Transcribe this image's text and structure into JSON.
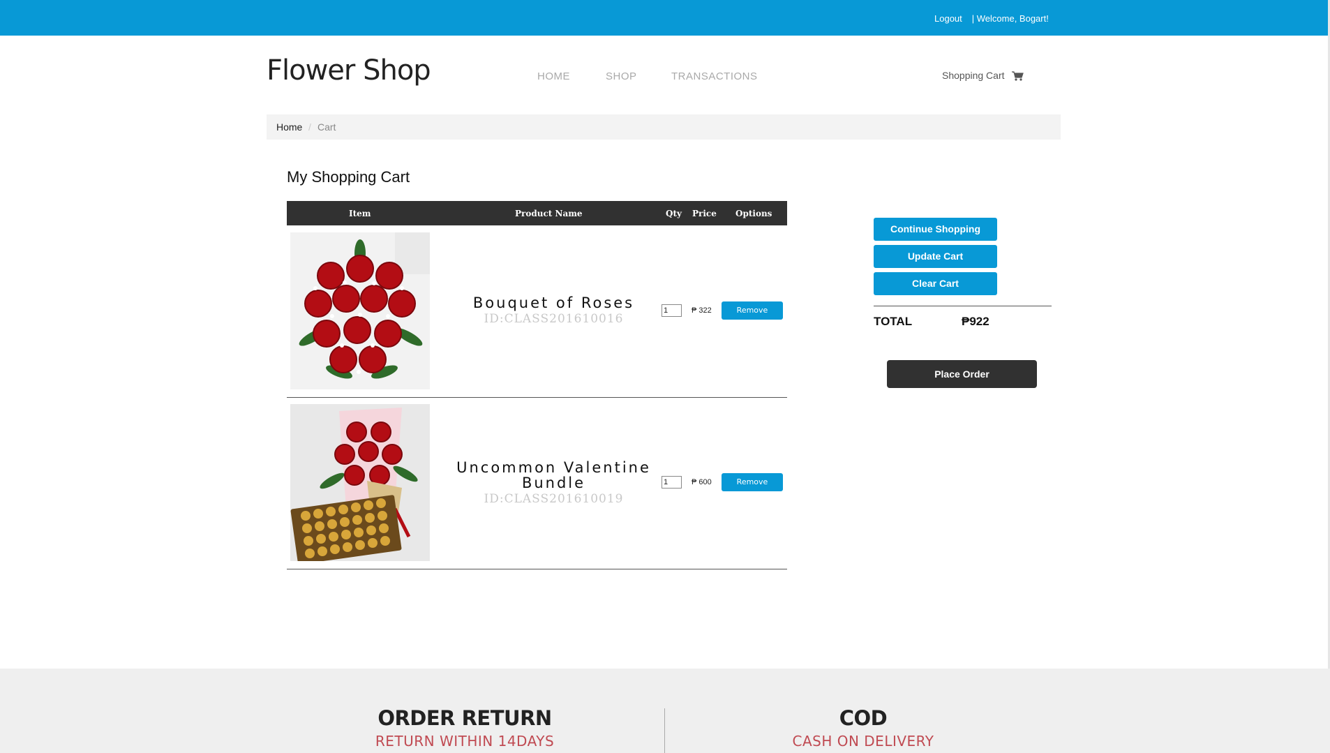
{
  "topbar": {
    "logout": "Logout",
    "welcome": "| Welcome,  Bogart!"
  },
  "header": {
    "logo": "Flower Shop",
    "nav": [
      "HOME",
      "SHOP",
      "TRANSACTIONS"
    ],
    "cart_link": "Shopping Cart"
  },
  "breadcrumb": {
    "home": "Home",
    "separator": "/",
    "current": "Cart"
  },
  "cart": {
    "title": "My Shopping Cart",
    "columns": {
      "item": "Item",
      "product_name": "Product Name",
      "qty": "Qty",
      "price": "Price",
      "options": "Options"
    },
    "rows": [
      {
        "name": "Bouquet of Roses",
        "id": "ID:CLASS201610016",
        "qty": "1",
        "price": "₱ 322",
        "remove": "Remove",
        "image": "bouquet-of-roses-photo"
      },
      {
        "name": "Uncommon Valentine Bundle",
        "id": "ID:CLASS201610019",
        "qty": "1",
        "price": "₱ 600",
        "remove": "Remove",
        "image": "valentine-bundle-photo"
      }
    ]
  },
  "sidebar": {
    "continue_shopping": "Continue Shopping",
    "update_cart": "Update Cart",
    "clear_cart": "Clear Cart",
    "total_label": "TOTAL",
    "total_value": "₱922",
    "place_order": "Place Order"
  },
  "footer": {
    "left_title": "ORDER RETURN",
    "left_sub": "RETURN WITHIN 14DAYS",
    "right_title": "COD",
    "right_sub": "CASH ON DELIVERY"
  },
  "colors": {
    "accent": "#0899d6",
    "dark": "#313131",
    "footer_accent": "#c04a52"
  }
}
